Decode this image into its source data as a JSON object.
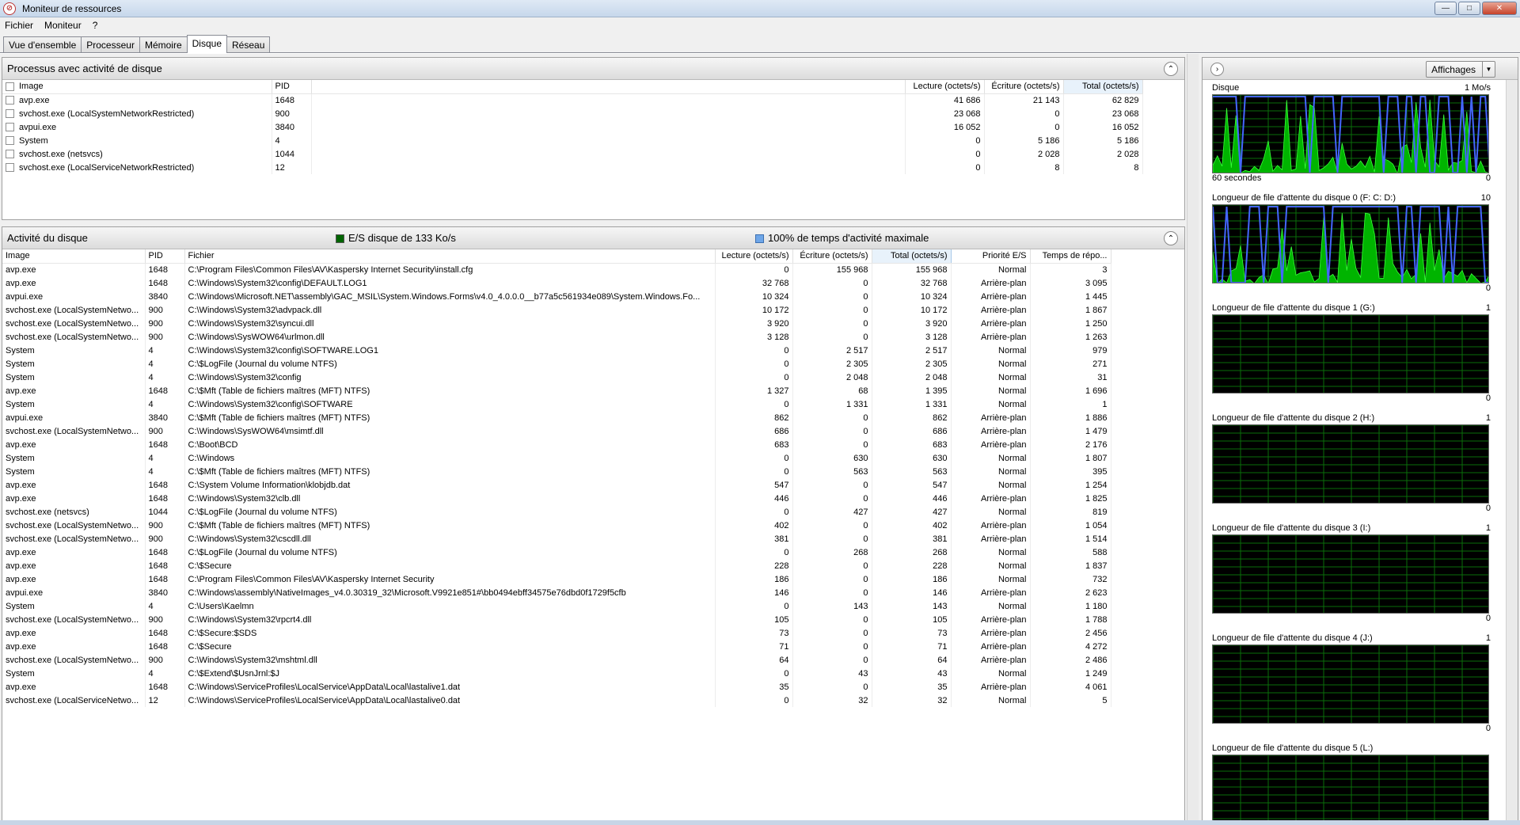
{
  "window": {
    "title": "Moniteur de ressources",
    "minimize": "—",
    "maximize": "□",
    "close": "✕",
    "icon": "resource-monitor-icon"
  },
  "menu": [
    "Fichier",
    "Moniteur",
    "?"
  ],
  "tabs": [
    "Vue d'ensemble",
    "Processeur",
    "Mémoire",
    "Disque",
    "Réseau"
  ],
  "active_tab": "Disque",
  "processes": {
    "title": "Processus avec activité de disque",
    "columns": [
      "Image",
      "PID",
      "Lecture (octets/s)",
      "Écriture (octets/s)",
      "Total (octets/s)"
    ],
    "rows": [
      [
        "avp.exe",
        "1648",
        "41 686",
        "21 143",
        "62 829"
      ],
      [
        "svchost.exe (LocalSystemNetworkRestricted)",
        "900",
        "23 068",
        "0",
        "23 068"
      ],
      [
        "avpui.exe",
        "3840",
        "16 052",
        "0",
        "16 052"
      ],
      [
        "System",
        "4",
        "0",
        "5 186",
        "5 186"
      ],
      [
        "svchost.exe (netsvcs)",
        "1044",
        "0",
        "2 028",
        "2 028"
      ],
      [
        "svchost.exe (LocalServiceNetworkRestricted)",
        "12",
        "0",
        "8",
        "8"
      ]
    ]
  },
  "disk_activity": {
    "title": "Activité du disque",
    "legend_io": "E/S disque de 133 Ko/s",
    "legend_active": "100% de temps d'activité maximale",
    "legend_io_color": "#006400",
    "legend_active_color": "#6ea6e8",
    "columns": [
      "Image",
      "PID",
      "Fichier",
      "Lecture (octets/s)",
      "Écriture (octets/s)",
      "Total (octets/s)",
      "Priorité E/S",
      "Temps de répo..."
    ],
    "rows": [
      [
        "avp.exe",
        "1648",
        "C:\\Program Files\\Common Files\\AV\\Kaspersky Internet Security\\install.cfg",
        "0",
        "155 968",
        "155 968",
        "Normal",
        "3"
      ],
      [
        "avp.exe",
        "1648",
        "C:\\Windows\\System32\\config\\DEFAULT.LOG1",
        "32 768",
        "0",
        "32 768",
        "Arrière-plan",
        "3 095"
      ],
      [
        "avpui.exe",
        "3840",
        "C:\\Windows\\Microsoft.NET\\assembly\\GAC_MSIL\\System.Windows.Forms\\v4.0_4.0.0.0__b77a5c561934e089\\System.Windows.Fo...",
        "10 324",
        "0",
        "10 324",
        "Arrière-plan",
        "1 445"
      ],
      [
        "svchost.exe (LocalSystemNetwo...",
        "900",
        "C:\\Windows\\System32\\advpack.dll",
        "10 172",
        "0",
        "10 172",
        "Arrière-plan",
        "1 867"
      ],
      [
        "svchost.exe (LocalSystemNetwo...",
        "900",
        "C:\\Windows\\System32\\syncui.dll",
        "3 920",
        "0",
        "3 920",
        "Arrière-plan",
        "1 250"
      ],
      [
        "svchost.exe (LocalSystemNetwo...",
        "900",
        "C:\\Windows\\SysWOW64\\urlmon.dll",
        "3 128",
        "0",
        "3 128",
        "Arrière-plan",
        "1 263"
      ],
      [
        "System",
        "4",
        "C:\\Windows\\System32\\config\\SOFTWARE.LOG1",
        "0",
        "2 517",
        "2 517",
        "Normal",
        "979"
      ],
      [
        "System",
        "4",
        "C:\\$LogFile (Journal du volume NTFS)",
        "0",
        "2 305",
        "2 305",
        "Normal",
        "271"
      ],
      [
        "System",
        "4",
        "C:\\Windows\\System32\\config",
        "0",
        "2 048",
        "2 048",
        "Normal",
        "31"
      ],
      [
        "avp.exe",
        "1648",
        "C:\\$Mft (Table de fichiers maîtres (MFT) NTFS)",
        "1 327",
        "68",
        "1 395",
        "Normal",
        "1 696"
      ],
      [
        "System",
        "4",
        "C:\\Windows\\System32\\config\\SOFTWARE",
        "0",
        "1 331",
        "1 331",
        "Normal",
        "1"
      ],
      [
        "avpui.exe",
        "3840",
        "C:\\$Mft (Table de fichiers maîtres (MFT) NTFS)",
        "862",
        "0",
        "862",
        "Arrière-plan",
        "1 886"
      ],
      [
        "svchost.exe (LocalSystemNetwo...",
        "900",
        "C:\\Windows\\SysWOW64\\msimtf.dll",
        "686",
        "0",
        "686",
        "Arrière-plan",
        "1 479"
      ],
      [
        "avp.exe",
        "1648",
        "C:\\Boot\\BCD",
        "683",
        "0",
        "683",
        "Arrière-plan",
        "2 176"
      ],
      [
        "System",
        "4",
        "C:\\Windows",
        "0",
        "630",
        "630",
        "Normal",
        "1 807"
      ],
      [
        "System",
        "4",
        "C:\\$Mft (Table de fichiers maîtres (MFT) NTFS)",
        "0",
        "563",
        "563",
        "Normal",
        "395"
      ],
      [
        "avp.exe",
        "1648",
        "C:\\System Volume Information\\klobjdb.dat",
        "547",
        "0",
        "547",
        "Normal",
        "1 254"
      ],
      [
        "avp.exe",
        "1648",
        "C:\\Windows\\System32\\clb.dll",
        "446",
        "0",
        "446",
        "Arrière-plan",
        "1 825"
      ],
      [
        "svchost.exe (netsvcs)",
        "1044",
        "C:\\$LogFile (Journal du volume NTFS)",
        "0",
        "427",
        "427",
        "Normal",
        "819"
      ],
      [
        "svchost.exe (LocalSystemNetwo...",
        "900",
        "C:\\$Mft (Table de fichiers maîtres (MFT) NTFS)",
        "402",
        "0",
        "402",
        "Arrière-plan",
        "1 054"
      ],
      [
        "svchost.exe (LocalSystemNetwo...",
        "900",
        "C:\\Windows\\System32\\cscdll.dll",
        "381",
        "0",
        "381",
        "Arrière-plan",
        "1 514"
      ],
      [
        "avp.exe",
        "1648",
        "C:\\$LogFile (Journal du volume NTFS)",
        "0",
        "268",
        "268",
        "Normal",
        "588"
      ],
      [
        "avp.exe",
        "1648",
        "C:\\$Secure",
        "228",
        "0",
        "228",
        "Normal",
        "1 837"
      ],
      [
        "avp.exe",
        "1648",
        "C:\\Program Files\\Common Files\\AV\\Kaspersky Internet Security",
        "186",
        "0",
        "186",
        "Normal",
        "732"
      ],
      [
        "avpui.exe",
        "3840",
        "C:\\Windows\\assembly\\NativeImages_v4.0.30319_32\\Microsoft.V9921e851#\\bb0494ebff34575e76dbd0f1729f5cfb",
        "146",
        "0",
        "146",
        "Arrière-plan",
        "2 623"
      ],
      [
        "System",
        "4",
        "C:\\Users\\Kaelmn",
        "0",
        "143",
        "143",
        "Normal",
        "1 180"
      ],
      [
        "svchost.exe (LocalSystemNetwo...",
        "900",
        "C:\\Windows\\System32\\rpcrt4.dll",
        "105",
        "0",
        "105",
        "Arrière-plan",
        "1 788"
      ],
      [
        "avp.exe",
        "1648",
        "C:\\$Secure:$SDS",
        "73",
        "0",
        "73",
        "Arrière-plan",
        "2 456"
      ],
      [
        "avp.exe",
        "1648",
        "C:\\$Secure",
        "71",
        "0",
        "71",
        "Arrière-plan",
        "4 272"
      ],
      [
        "svchost.exe (LocalSystemNetwo...",
        "900",
        "C:\\Windows\\System32\\mshtml.dll",
        "64",
        "0",
        "64",
        "Arrière-plan",
        "2 486"
      ],
      [
        "System",
        "4",
        "C:\\$Extend\\$UsnJrnl:$J",
        "0",
        "43",
        "43",
        "Normal",
        "1 249"
      ],
      [
        "avp.exe",
        "1648",
        "C:\\Windows\\ServiceProfiles\\LocalService\\AppData\\Local\\lastalive1.dat",
        "35",
        "0",
        "35",
        "Arrière-plan",
        "4 061"
      ],
      [
        "svchost.exe (LocalServiceNetwo...",
        "12",
        "C:\\Windows\\ServiceProfiles\\LocalService\\AppData\\Local\\lastalive0.dat",
        "0",
        "32",
        "32",
        "Normal",
        "5"
      ]
    ]
  },
  "right_panel": {
    "view_button": "Affichages",
    "graphs": [
      {
        "label": "Disque",
        "max": "1 Mo/s",
        "footer_left": "60 secondes",
        "min": "0",
        "active": true
      },
      {
        "label": "Longueur de file d'attente du disque 0 (F: C: D:)",
        "max": "10",
        "footer_left": "",
        "min": "0",
        "active": true
      },
      {
        "label": "Longueur de file d'attente du disque 1 (G:)",
        "max": "1",
        "footer_left": "",
        "min": "0",
        "active": false
      },
      {
        "label": "Longueur de file d'attente du disque 2 (H:)",
        "max": "1",
        "footer_left": "",
        "min": "0",
        "active": false
      },
      {
        "label": "Longueur de file d'attente du disque 3 (I:)",
        "max": "1",
        "footer_left": "",
        "min": "0",
        "active": false
      },
      {
        "label": "Longueur de file d'attente du disque 4 (J:)",
        "max": "1",
        "footer_left": "",
        "min": "0",
        "active": false
      },
      {
        "label": "Longueur de file d'attente du disque 5 (L:)",
        "max": "",
        "footer_left": "",
        "min": "",
        "active": false
      }
    ],
    "graph_colors": {
      "background": "#000000",
      "grid": "#0a6e0a",
      "fill": "#00b400",
      "line": "#4466ff"
    }
  }
}
